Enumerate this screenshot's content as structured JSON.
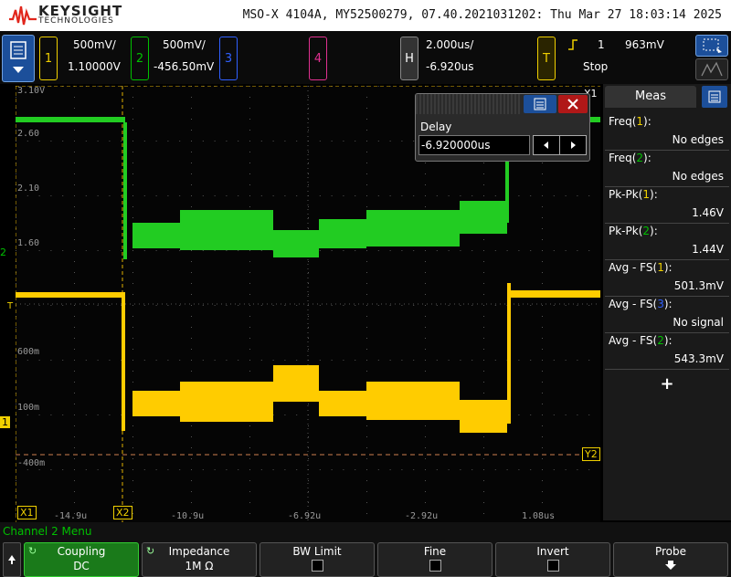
{
  "header": {
    "brand": "KEYSIGHT",
    "brand_sub": "TECHNOLOGIES",
    "title": "MSO-X 4104A, MY52500279, 07.40.2021031202: Thu Mar 27 18:03:14 2025"
  },
  "channels": [
    {
      "num": "1",
      "scale": "500mV/",
      "offset": "1.10000V",
      "color": "#f0d000"
    },
    {
      "num": "2",
      "scale": "500mV/",
      "offset": "-456.50mV",
      "color": "#00c000"
    },
    {
      "num": "3",
      "color": "#3060ff"
    },
    {
      "num": "4",
      "color": "#e03090"
    }
  ],
  "horizontal": {
    "label": "H",
    "timebase": "2.000us/",
    "delay": "-6.920us"
  },
  "trigger": {
    "label": "T",
    "source": "1",
    "level": "963mV",
    "status": "Stop",
    "edge_icon": "rising-edge-icon"
  },
  "delay_popup": {
    "title": "Delay",
    "value": "-6.920000us"
  },
  "graticule": {
    "ch1_labels": [
      "3.10V",
      "2.60",
      "2.10",
      "1.60"
    ],
    "ch2_labels": [
      "600m",
      "100m",
      "-400m"
    ],
    "time_labels": [
      "-14.9u",
      "-10.9u",
      "-6.92u",
      "-2.92u",
      "1.08us"
    ],
    "markers": {
      "x1": "X1",
      "x2": "X2",
      "y2": "Y2",
      "ch1": "1",
      "ch2": "2",
      "trig": "T",
      "x1_top": "X1"
    }
  },
  "measurements": {
    "title": "Meas",
    "items": [
      {
        "name": "Freq",
        "ch": "1",
        "close": "):",
        "value": "No edges",
        "ch_color": "#f0d000"
      },
      {
        "name": "Freq",
        "ch": "2",
        "close": "):",
        "value": "No edges",
        "ch_color": "#00c000"
      },
      {
        "name": "Pk-Pk",
        "ch": "1",
        "close": "):",
        "value": "1.46V",
        "ch_color": "#f0d000"
      },
      {
        "name": "Pk-Pk",
        "ch": "2",
        "close": "):",
        "value": "1.44V",
        "ch_color": "#00c000"
      },
      {
        "name": "Avg - FS",
        "ch": "1",
        "close": "):",
        "value": "501.3mV",
        "ch_color": "#f0d000"
      },
      {
        "name": "Avg - FS",
        "ch": "3",
        "close": "):",
        "value": "No signal",
        "ch_color": "#3060ff"
      },
      {
        "name": "Avg - FS",
        "ch": "2",
        "close": "):",
        "value": "543.3mV",
        "ch_color": "#00c000"
      }
    ],
    "add": "+"
  },
  "menu": {
    "title": "Channel 2 Menu",
    "softkeys": [
      {
        "label": "Coupling",
        "value": "DC",
        "active": true
      },
      {
        "label": "Impedance",
        "value": "1M Ω"
      },
      {
        "label": "BW Limit"
      },
      {
        "label": "Fine"
      },
      {
        "label": "Invert"
      },
      {
        "label": "Probe"
      }
    ]
  }
}
